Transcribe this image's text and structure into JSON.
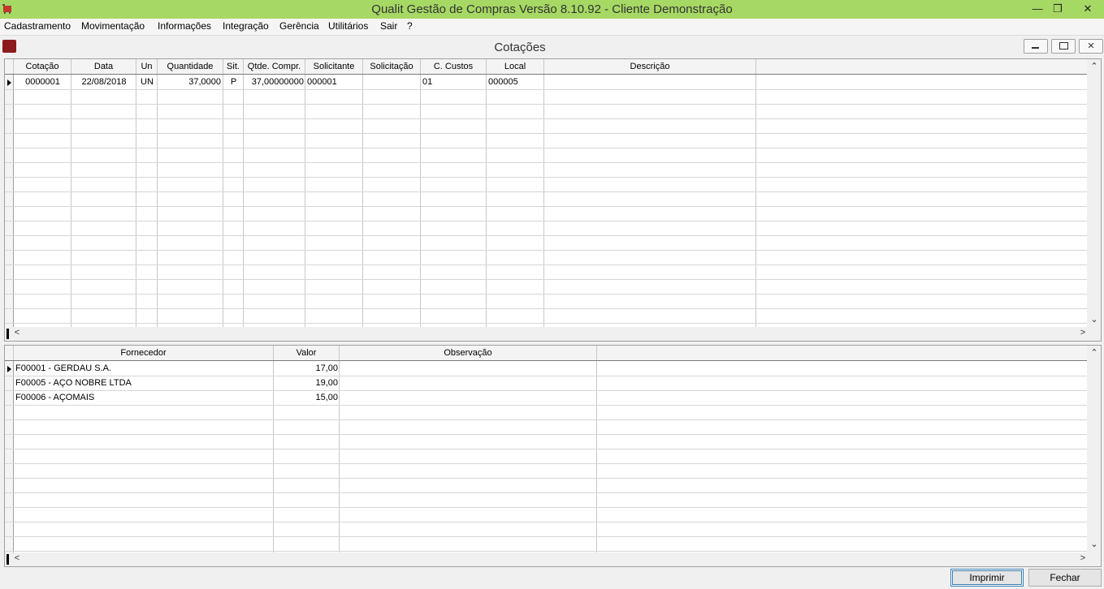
{
  "window": {
    "title": "Qualit Gestão de Compras Versão 8.10.92 - Cliente Demonstração"
  },
  "menu": [
    "Cadastramento",
    "Movimentação",
    "Informações",
    "Integração",
    "Gerência",
    "Utilitários",
    "Sair",
    "?"
  ],
  "child": {
    "title": "Cotações"
  },
  "quotes_table": {
    "columns": [
      "Cotação",
      "Data",
      "Un",
      "Quantidade",
      "Sit.",
      "Qtde. Compr.",
      "Solicitante",
      "Solicitação",
      "C. Custos",
      "Local",
      "Descrição"
    ],
    "rows": [
      {
        "cotacao": "0000001",
        "data": "22/08/2018",
        "un": "UN",
        "quantidade": "37,0000",
        "sit": "P",
        "qtde_compr": "37,00000000",
        "solicitante": "000001",
        "solicitacao": "",
        "c_custos": "01",
        "local": "000005",
        "descricao": ""
      }
    ]
  },
  "suppliers_table": {
    "columns": [
      "Fornecedor",
      "Valor",
      "Observação"
    ],
    "rows": [
      {
        "fornecedor": "F00001 - GERDAU S.A.",
        "valor": "17,00",
        "observacao": ""
      },
      {
        "fornecedor": "F00005 - AÇO NOBRE LTDA",
        "valor": "19,00",
        "observacao": ""
      },
      {
        "fornecedor": "F00006 - AÇOMAIS",
        "valor": "15,00",
        "observacao": ""
      }
    ]
  },
  "buttons": {
    "print": "Imprimir",
    "close": "Fechar"
  }
}
